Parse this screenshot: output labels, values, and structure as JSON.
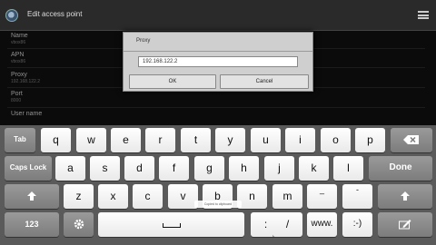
{
  "window": {
    "title": "Edit access point"
  },
  "settings": [
    {
      "label": "Name",
      "value": "vbox86"
    },
    {
      "label": "APN",
      "value": "vbox86"
    },
    {
      "label": "Proxy",
      "value": "192.168.122.2"
    },
    {
      "label": "Port",
      "value": "8000"
    },
    {
      "label": "User name",
      "value": ""
    }
  ],
  "dialog": {
    "title": "Proxy",
    "input_value": "192.168.122.2",
    "ok_label": "OK",
    "cancel_label": "Cancel"
  },
  "keyboard": {
    "tab": "Tab",
    "caps_lock": "Caps Lock",
    "done": "Done",
    "numbers": "123",
    "www": "www.",
    "smiley": ":-)",
    "row1": [
      "q",
      "w",
      "e",
      "r",
      "t",
      "y",
      "u",
      "i",
      "o",
      "p"
    ],
    "row2": [
      "a",
      "s",
      "d",
      "f",
      "g",
      "h",
      "j",
      "k",
      "l"
    ],
    "row3": [
      "z",
      "x",
      "c",
      "v",
      "b",
      "n",
      "m"
    ],
    "colon": ":",
    "slash": "/",
    "underscore": "_",
    "dash": "-",
    "tooltip": "Copied to clipboard"
  },
  "colors": {
    "key_face": "#ffffff",
    "fn_key": "#8a8a8a",
    "keyboard_bg": "#5a5a5a"
  }
}
